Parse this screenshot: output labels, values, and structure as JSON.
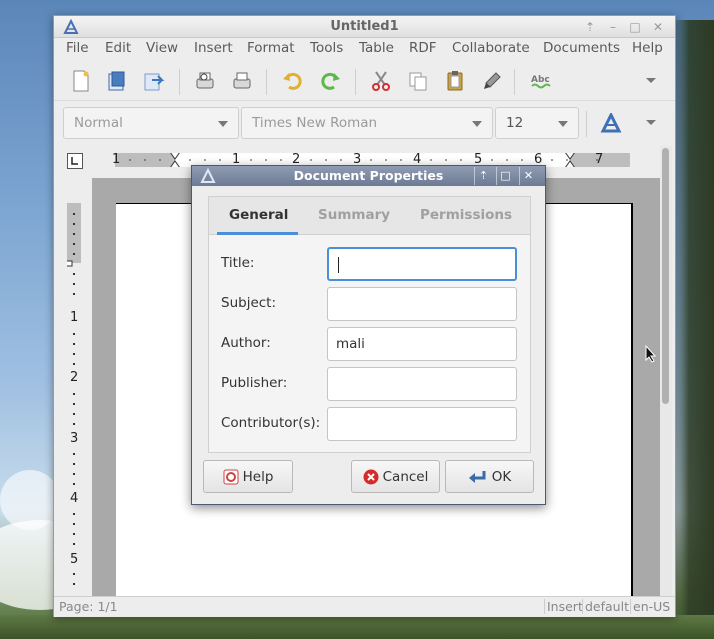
{
  "window": {
    "title": "Untitled1"
  },
  "menubar": {
    "items": [
      "File",
      "Edit",
      "View",
      "Insert",
      "Format",
      "Tools",
      "Table",
      "RDF",
      "Collaborate",
      "Documents",
      "Help"
    ]
  },
  "toolbar": {
    "icons": [
      "new-document-icon",
      "open-icon",
      "save-icon",
      "print-preview-icon",
      "print-icon",
      "undo-icon",
      "redo-icon",
      "cut-icon",
      "copy-icon",
      "paste-icon",
      "format-painter-icon",
      "spellcheck-icon",
      "toolbar-overflow-icon"
    ]
  },
  "formatbar": {
    "style_value": "Normal",
    "font_value": "Times New Roman",
    "size_value": "12"
  },
  "ruler": {
    "h_numbers": [
      "1",
      "1",
      "2",
      "3",
      "4",
      "5",
      "6",
      "7"
    ],
    "v_numbers": [
      "1",
      "2",
      "3",
      "4",
      "5"
    ]
  },
  "statusbar": {
    "page": "Page: 1/1",
    "mode": "Insert",
    "style": "default",
    "lang": "en-US"
  },
  "dialog": {
    "title": "Document Properties",
    "tabs": [
      {
        "label": "General"
      },
      {
        "label": "Summary"
      },
      {
        "label": "Permissions"
      }
    ],
    "fields": [
      {
        "label": "Title:",
        "value": ""
      },
      {
        "label": "Subject:",
        "value": ""
      },
      {
        "label": "Author:",
        "value": "mali"
      },
      {
        "label": "Publisher:",
        "value": ""
      },
      {
        "label": "Contributor(s):",
        "value": ""
      }
    ],
    "buttons": {
      "help": "Help",
      "cancel": "Cancel",
      "ok": "OK"
    }
  },
  "colors": {
    "accent": "#4a90d9",
    "dialog_titlebar": "#7a879f",
    "cancel_icon": "#d62b2b"
  }
}
